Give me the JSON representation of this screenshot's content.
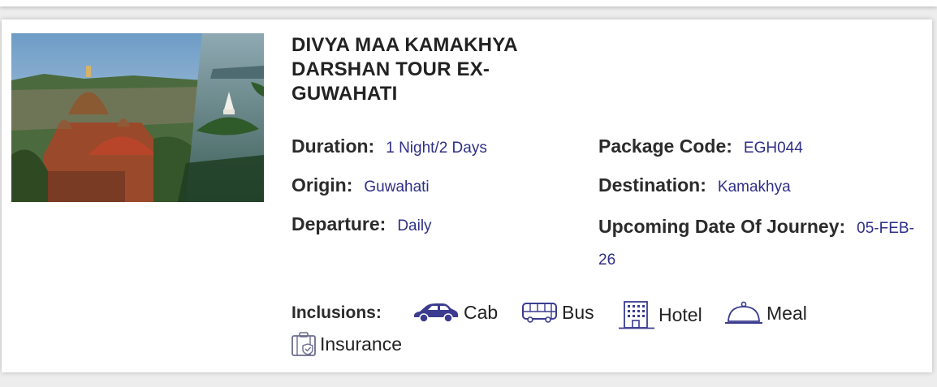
{
  "package": {
    "title": "DIVYA MAA KAMAKHYA DARSHAN TOUR EX-GUWAHATI",
    "duration_label": "Duration:",
    "duration": "1 Night/2 Days",
    "origin_label": "Origin:",
    "origin": "Guwahati",
    "departure_label": "Departure:",
    "departure": "Daily",
    "code_label": "Package Code:",
    "code": "EGH044",
    "destination_label": "Destination:",
    "destination": "Kamakhya",
    "upcoming_label": "Upcoming Date Of Journey:",
    "upcoming": "05-FEB-26"
  },
  "inclusions": {
    "label": "Inclusions:",
    "items": [
      {
        "icon": "car-icon",
        "label": "Cab"
      },
      {
        "icon": "bus-icon",
        "label": "Bus"
      },
      {
        "icon": "hotel-icon",
        "label": "Hotel"
      },
      {
        "icon": "meal-cloche-icon",
        "label": "Meal"
      },
      {
        "icon": "insurance-icon",
        "label": "Insurance"
      }
    ]
  },
  "colors": {
    "value_text": "#2e2f86",
    "icon": "#3b3c8f"
  }
}
